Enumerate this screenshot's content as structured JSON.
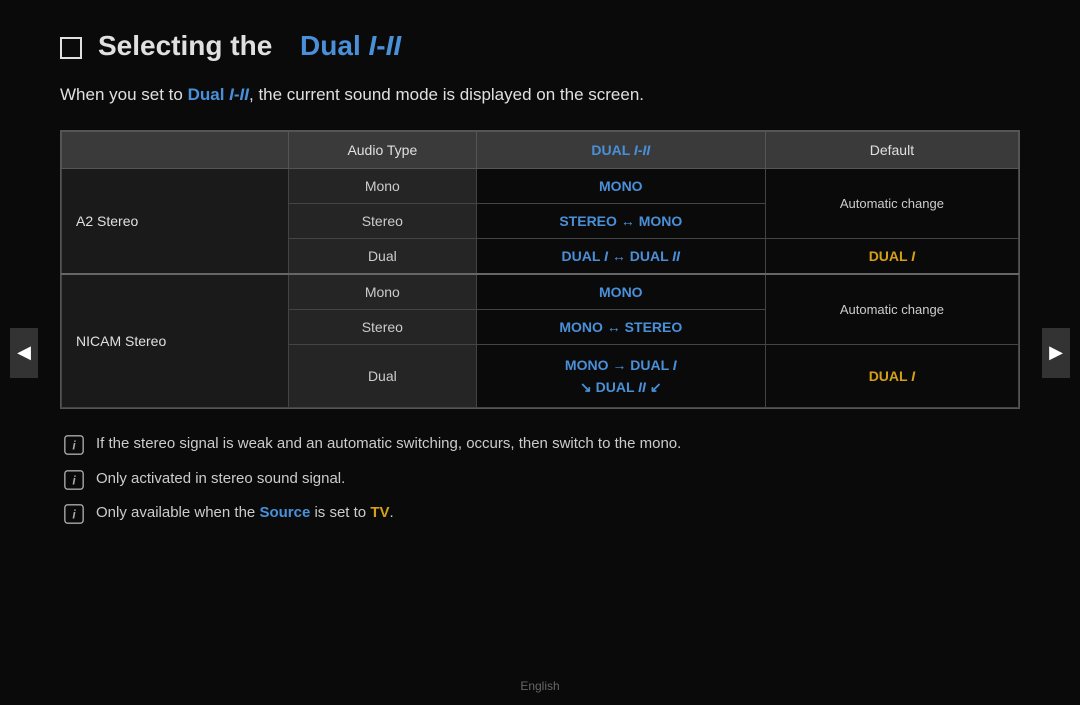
{
  "page": {
    "title_prefix": "Selecting the",
    "title_highlight": "Dual I-II",
    "subtitle_prefix": "When you set to",
    "subtitle_highlight": "Dual I-II",
    "subtitle_suffix": ", the current sound mode is displayed on the screen."
  },
  "table": {
    "headers": [
      "",
      "Audio Type",
      "DUAL I-II",
      "Default"
    ],
    "rows": [
      {
        "group_label": "A2 Stereo",
        "entries": [
          {
            "audio_type": "Mono",
            "dual_value": "MONO",
            "default_value": "",
            "default_span_note": "Automatic change"
          },
          {
            "audio_type": "Stereo",
            "dual_value": "STEREO ↔ MONO",
            "default_value": ""
          },
          {
            "audio_type": "Dual",
            "dual_value": "DUAL I ↔ DUAL II",
            "default_value": "DUAL I"
          }
        ]
      },
      {
        "group_label": "NICAM Stereo",
        "entries": [
          {
            "audio_type": "Mono",
            "dual_value": "MONO",
            "default_value": "",
            "default_span_note": "Automatic change"
          },
          {
            "audio_type": "Stereo",
            "dual_value": "MONO ↔ STEREO",
            "default_value": ""
          },
          {
            "audio_type": "Dual",
            "dual_value_line1": "MONO → DUAL I",
            "dual_value_line2": "↘ DUAL II ↙",
            "default_value": "DUAL I"
          }
        ]
      }
    ]
  },
  "notes": [
    {
      "text": "If the stereo signal is weak and an automatic switching, occurs, then switch to the mono."
    },
    {
      "text": "Only activated in stereo sound signal."
    },
    {
      "text_prefix": "Only available when the",
      "highlight1": "Source",
      "text_middle": "is set to",
      "highlight2": "TV",
      "text_suffix": "."
    }
  ],
  "footer": {
    "language": "English"
  },
  "nav": {
    "left_arrow": "◀",
    "right_arrow": "▶"
  }
}
